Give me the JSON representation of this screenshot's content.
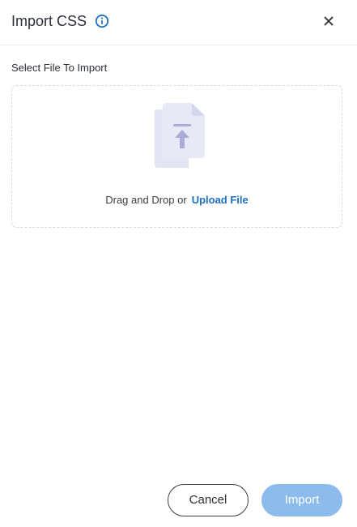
{
  "dialog": {
    "title": "Import CSS",
    "info_icon": "info-icon",
    "close_icon": "close-icon"
  },
  "upload": {
    "section_label": "Select File To Import",
    "illustration_icon": "file-upload-icon",
    "drop_prefix": "Drag and Drop or",
    "upload_link": "Upload File"
  },
  "footer": {
    "cancel_label": "Cancel",
    "import_label": "Import",
    "import_disabled": true
  },
  "colors": {
    "accent": "#1e6fc0",
    "import_disabled_bg": "#8dbbec",
    "illustration": "#d7d9f0"
  }
}
